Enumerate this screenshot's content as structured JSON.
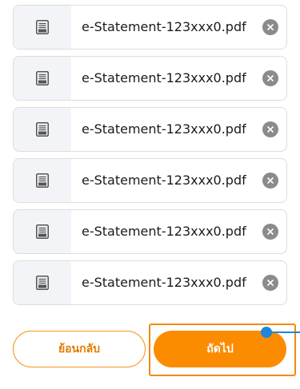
{
  "files": [
    {
      "name": "e-Statement-123xxx0.pdf",
      "icon": "pdf-file-icon"
    },
    {
      "name": "e-Statement-123xxx0.pdf",
      "icon": "pdf-file-icon"
    },
    {
      "name": "e-Statement-123xxx0.pdf",
      "icon": "pdf-file-icon"
    },
    {
      "name": "e-Statement-123xxx0.pdf",
      "icon": "pdf-file-icon"
    },
    {
      "name": "e-Statement-123xxx0.pdf",
      "icon": "pdf-file-icon"
    },
    {
      "name": "e-Statement-123xxx0.pdf",
      "icon": "pdf-file-icon"
    }
  ],
  "actions": {
    "back_label": "ย้อนกลับ",
    "next_label": "ถัดไป"
  },
  "colors": {
    "accent": "#fb8c00",
    "accent_outline": "#f7931e",
    "pointer": "#1f86d8",
    "remove_icon": "#8b8b8b",
    "icon_bg": "#f2f4f8"
  }
}
